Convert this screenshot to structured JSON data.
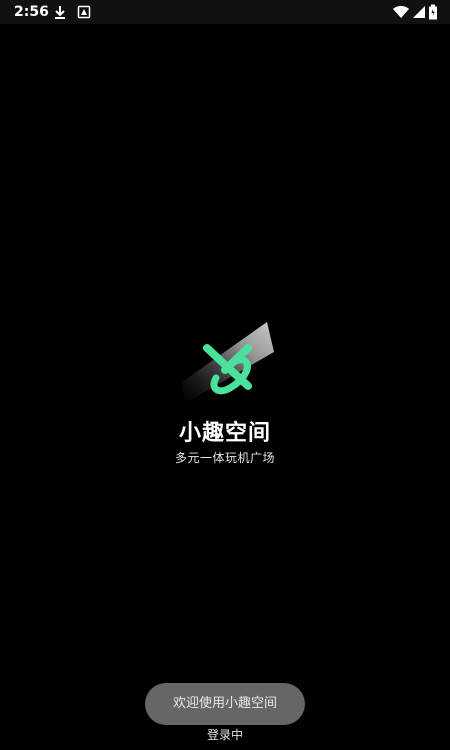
{
  "status_bar": {
    "time": "2:56",
    "icons": [
      "download-icon",
      "app-notification-icon",
      "wifi-icon",
      "signal-icon",
      "battery-icon"
    ]
  },
  "brand": {
    "title": "小趣空间",
    "subtitle": "多元一体玩机广场",
    "logo": {
      "name": "app-logo-icon",
      "accent": "#4BE09B"
    }
  },
  "toast": {
    "message": "欢迎使用小趣空间"
  },
  "status_text": "登录中"
}
